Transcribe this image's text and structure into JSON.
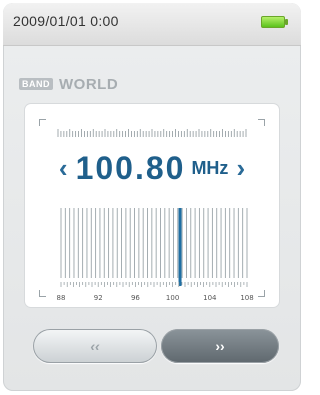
{
  "status": {
    "datetime": "2009/01/01   0:00",
    "battery_icon": "battery-full-icon",
    "battery_color": "#5cc21c"
  },
  "band": {
    "tag": "BAND",
    "value": "WORLD"
  },
  "tuner": {
    "prev_arrow": "‹",
    "next_arrow": "›",
    "frequency": "100.80",
    "unit": "MHz",
    "accent_color": "#1f5f8b",
    "scale_labels": [
      "88",
      "92",
      "96",
      "100",
      "104",
      "108"
    ],
    "scale_min_mhz": 88,
    "scale_max_mhz": 108,
    "current_mhz": 100.8
  },
  "controls": {
    "prev_label": "‹‹",
    "next_label": "››"
  }
}
